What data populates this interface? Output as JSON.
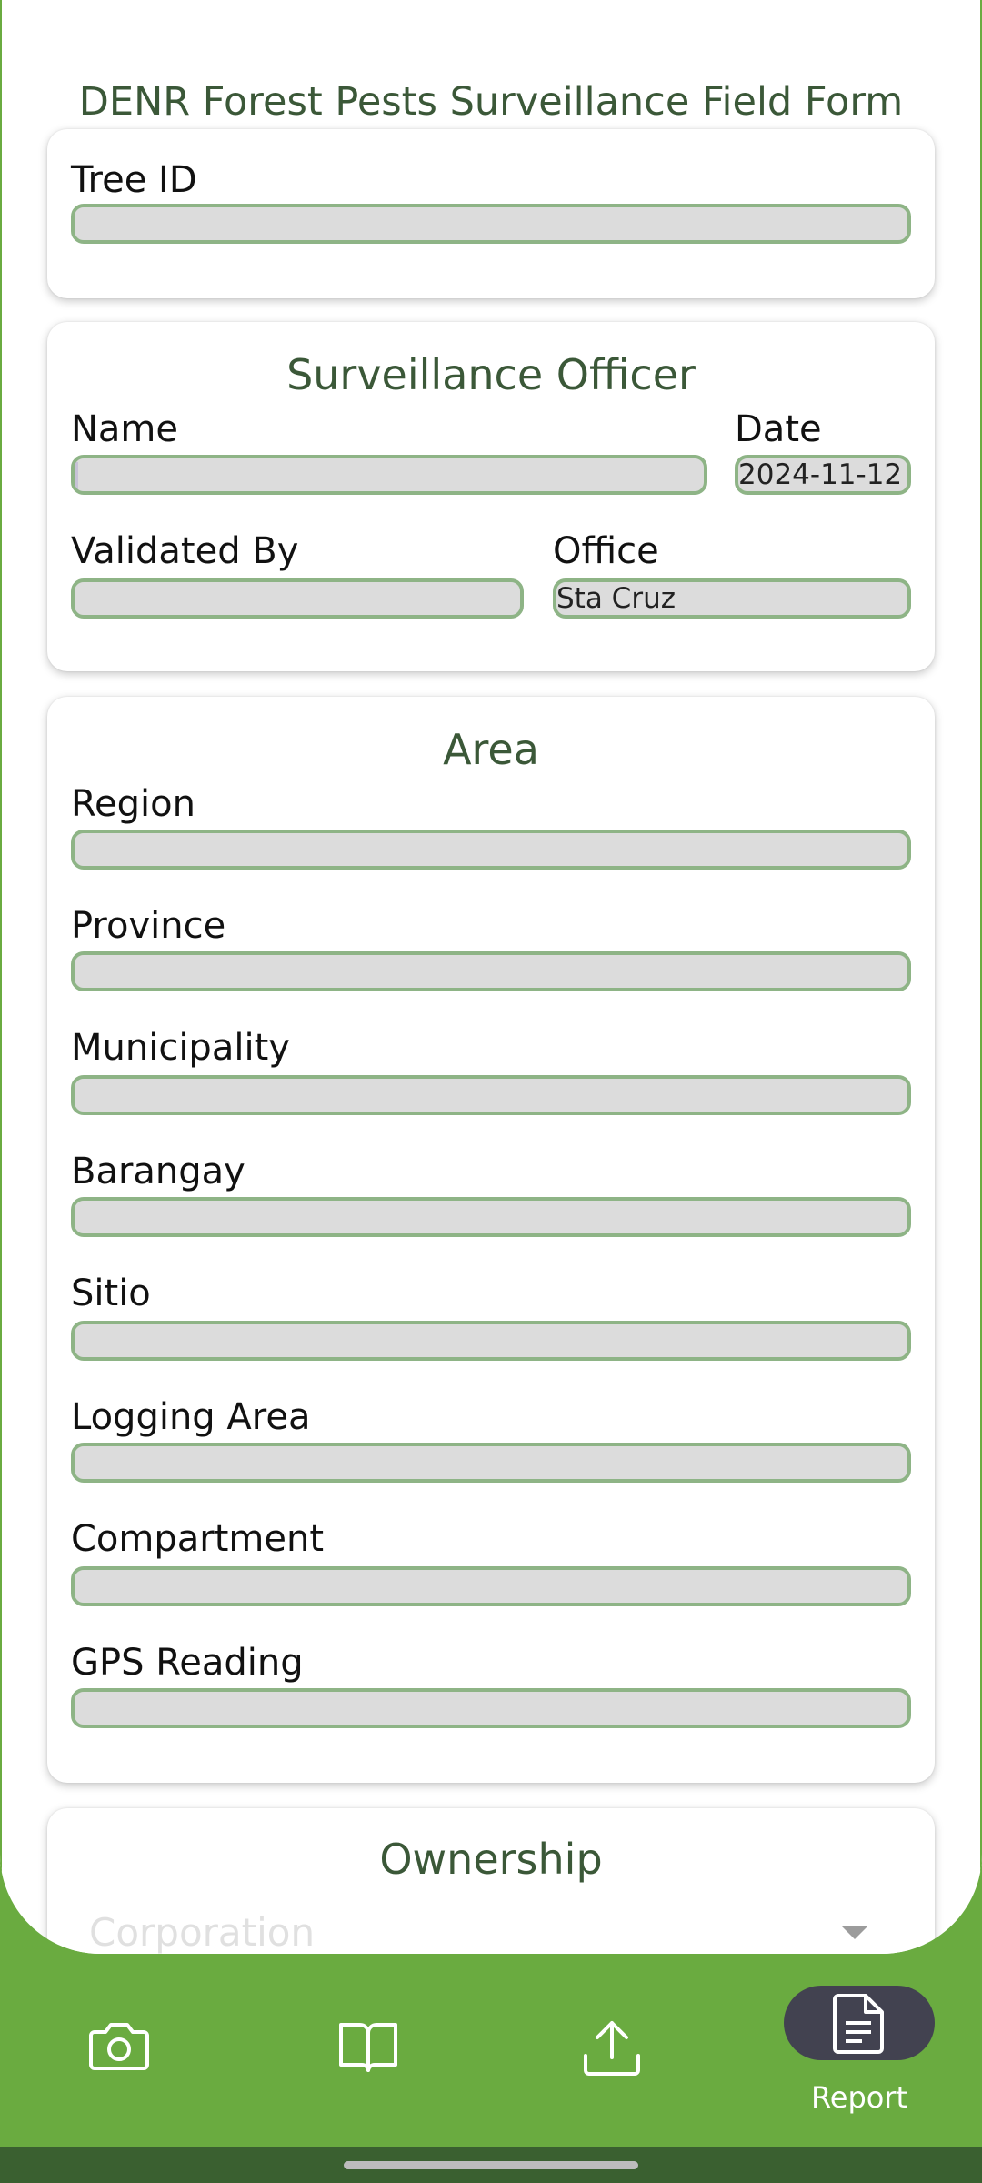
{
  "form": {
    "title": "DENR Forest Pests Surveillance Field Form"
  },
  "tree_card": {
    "tree_id_label": "Tree ID",
    "tree_id_value": ""
  },
  "officer_card": {
    "title": "Surveillance Officer",
    "name_label": "Name",
    "name_value": "",
    "date_label": "Date",
    "date_value": "2024-11-12",
    "validated_by_label": "Validated By",
    "validated_by_value": "",
    "office_label": "Office",
    "office_value": "Sta Cruz"
  },
  "area_card": {
    "title": "Area",
    "fields": [
      {
        "label": "Region",
        "value": ""
      },
      {
        "label": "Province",
        "value": ""
      },
      {
        "label": "Municipality",
        "value": ""
      },
      {
        "label": "Barangay",
        "value": ""
      },
      {
        "label": "Sitio",
        "value": ""
      },
      {
        "label": "Logging Area",
        "value": ""
      },
      {
        "label": "Compartment",
        "value": ""
      },
      {
        "label": "GPS Reading",
        "value": ""
      }
    ]
  },
  "ownership_card": {
    "title": "Ownership",
    "selected": "Corporation"
  },
  "bottom_nav": {
    "items": [
      {
        "icon": "camera-icon",
        "label": ""
      },
      {
        "icon": "book-icon",
        "label": ""
      },
      {
        "icon": "upload-icon",
        "label": ""
      },
      {
        "icon": "report-icon",
        "label": "Report",
        "active": true
      }
    ],
    "accent_color": "#6aab40",
    "active_pill_color": "#424250"
  }
}
